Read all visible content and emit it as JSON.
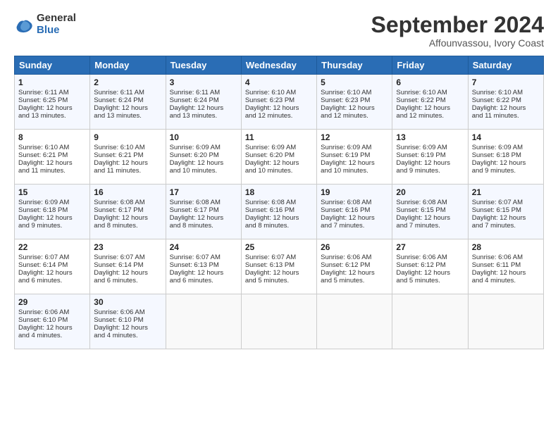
{
  "logo": {
    "general": "General",
    "blue": "Blue"
  },
  "title": "September 2024",
  "location": "Affounvassou, Ivory Coast",
  "days": [
    "Sunday",
    "Monday",
    "Tuesday",
    "Wednesday",
    "Thursday",
    "Friday",
    "Saturday"
  ],
  "weeks": [
    [
      {
        "day": "1",
        "sunrise": "6:11 AM",
        "sunset": "6:25 PM",
        "daylight": "12 hours and 13 minutes."
      },
      {
        "day": "2",
        "sunrise": "6:11 AM",
        "sunset": "6:24 PM",
        "daylight": "12 hours and 13 minutes."
      },
      {
        "day": "3",
        "sunrise": "6:11 AM",
        "sunset": "6:24 PM",
        "daylight": "12 hours and 13 minutes."
      },
      {
        "day": "4",
        "sunrise": "6:10 AM",
        "sunset": "6:23 PM",
        "daylight": "12 hours and 12 minutes."
      },
      {
        "day": "5",
        "sunrise": "6:10 AM",
        "sunset": "6:23 PM",
        "daylight": "12 hours and 12 minutes."
      },
      {
        "day": "6",
        "sunrise": "6:10 AM",
        "sunset": "6:22 PM",
        "daylight": "12 hours and 12 minutes."
      },
      {
        "day": "7",
        "sunrise": "6:10 AM",
        "sunset": "6:22 PM",
        "daylight": "12 hours and 11 minutes."
      }
    ],
    [
      {
        "day": "8",
        "sunrise": "6:10 AM",
        "sunset": "6:21 PM",
        "daylight": "12 hours and 11 minutes."
      },
      {
        "day": "9",
        "sunrise": "6:10 AM",
        "sunset": "6:21 PM",
        "daylight": "12 hours and 11 minutes."
      },
      {
        "day": "10",
        "sunrise": "6:09 AM",
        "sunset": "6:20 PM",
        "daylight": "12 hours and 10 minutes."
      },
      {
        "day": "11",
        "sunrise": "6:09 AM",
        "sunset": "6:20 PM",
        "daylight": "12 hours and 10 minutes."
      },
      {
        "day": "12",
        "sunrise": "6:09 AM",
        "sunset": "6:19 PM",
        "daylight": "12 hours and 10 minutes."
      },
      {
        "day": "13",
        "sunrise": "6:09 AM",
        "sunset": "6:19 PM",
        "daylight": "12 hours and 9 minutes."
      },
      {
        "day": "14",
        "sunrise": "6:09 AM",
        "sunset": "6:18 PM",
        "daylight": "12 hours and 9 minutes."
      }
    ],
    [
      {
        "day": "15",
        "sunrise": "6:09 AM",
        "sunset": "6:18 PM",
        "daylight": "12 hours and 9 minutes."
      },
      {
        "day": "16",
        "sunrise": "6:08 AM",
        "sunset": "6:17 PM",
        "daylight": "12 hours and 8 minutes."
      },
      {
        "day": "17",
        "sunrise": "6:08 AM",
        "sunset": "6:17 PM",
        "daylight": "12 hours and 8 minutes."
      },
      {
        "day": "18",
        "sunrise": "6:08 AM",
        "sunset": "6:16 PM",
        "daylight": "12 hours and 8 minutes."
      },
      {
        "day": "19",
        "sunrise": "6:08 AM",
        "sunset": "6:16 PM",
        "daylight": "12 hours and 7 minutes."
      },
      {
        "day": "20",
        "sunrise": "6:08 AM",
        "sunset": "6:15 PM",
        "daylight": "12 hours and 7 minutes."
      },
      {
        "day": "21",
        "sunrise": "6:07 AM",
        "sunset": "6:15 PM",
        "daylight": "12 hours and 7 minutes."
      }
    ],
    [
      {
        "day": "22",
        "sunrise": "6:07 AM",
        "sunset": "6:14 PM",
        "daylight": "12 hours and 6 minutes."
      },
      {
        "day": "23",
        "sunrise": "6:07 AM",
        "sunset": "6:14 PM",
        "daylight": "12 hours and 6 minutes."
      },
      {
        "day": "24",
        "sunrise": "6:07 AM",
        "sunset": "6:13 PM",
        "daylight": "12 hours and 6 minutes."
      },
      {
        "day": "25",
        "sunrise": "6:07 AM",
        "sunset": "6:13 PM",
        "daylight": "12 hours and 5 minutes."
      },
      {
        "day": "26",
        "sunrise": "6:06 AM",
        "sunset": "6:12 PM",
        "daylight": "12 hours and 5 minutes."
      },
      {
        "day": "27",
        "sunrise": "6:06 AM",
        "sunset": "6:12 PM",
        "daylight": "12 hours and 5 minutes."
      },
      {
        "day": "28",
        "sunrise": "6:06 AM",
        "sunset": "6:11 PM",
        "daylight": "12 hours and 4 minutes."
      }
    ],
    [
      {
        "day": "29",
        "sunrise": "6:06 AM",
        "sunset": "6:10 PM",
        "daylight": "12 hours and 4 minutes."
      },
      {
        "day": "30",
        "sunrise": "6:06 AM",
        "sunset": "6:10 PM",
        "daylight": "12 hours and 4 minutes."
      },
      null,
      null,
      null,
      null,
      null
    ]
  ]
}
